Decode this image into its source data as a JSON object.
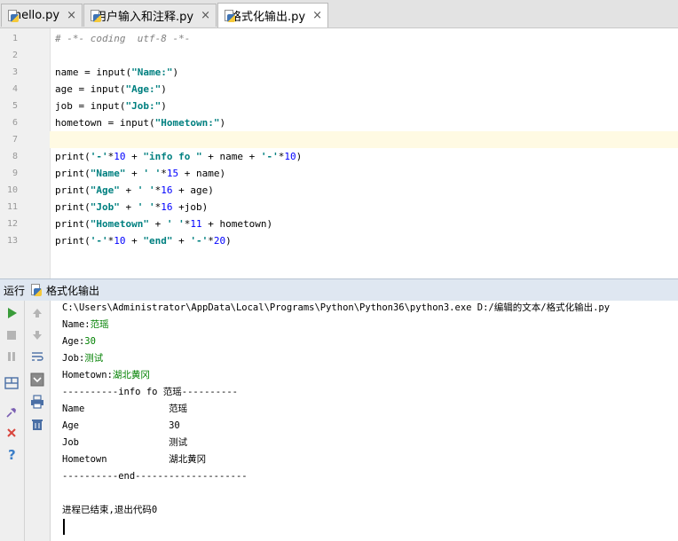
{
  "tabs": [
    {
      "label": "hello.py",
      "close": "×",
      "active": false
    },
    {
      "label": "用户输入和注释.py",
      "close": "×",
      "active": false
    },
    {
      "label": "格式化输出.py",
      "close": "×",
      "active": true
    }
  ],
  "editor": {
    "current_line": 7,
    "lines": [
      {
        "n": "1",
        "tokens": [
          {
            "t": "# -*- coding  utf-8 -*-",
            "k": "comment"
          }
        ]
      },
      {
        "n": "2",
        "tokens": []
      },
      {
        "n": "3",
        "tokens": [
          {
            "t": "name = input(",
            "k": "plain"
          },
          {
            "t": "\"Name:\"",
            "k": "str"
          },
          {
            "t": ")",
            "k": "plain"
          }
        ]
      },
      {
        "n": "4",
        "tokens": [
          {
            "t": "age = input(",
            "k": "plain"
          },
          {
            "t": "\"Age:\"",
            "k": "str"
          },
          {
            "t": ")",
            "k": "plain"
          }
        ]
      },
      {
        "n": "5",
        "tokens": [
          {
            "t": "job = input(",
            "k": "plain"
          },
          {
            "t": "\"Job:\"",
            "k": "str"
          },
          {
            "t": ")",
            "k": "plain"
          }
        ]
      },
      {
        "n": "6",
        "tokens": [
          {
            "t": "hometown = input(",
            "k": "plain"
          },
          {
            "t": "\"Hometown:\"",
            "k": "str"
          },
          {
            "t": ")",
            "k": "plain"
          }
        ]
      },
      {
        "n": "7",
        "tokens": []
      },
      {
        "n": "8",
        "tokens": [
          {
            "t": "print(",
            "k": "plain"
          },
          {
            "t": "'-'",
            "k": "str"
          },
          {
            "t": "*",
            "k": "plain"
          },
          {
            "t": "10",
            "k": "num"
          },
          {
            "t": " + ",
            "k": "plain"
          },
          {
            "t": "\"info fo \"",
            "k": "str"
          },
          {
            "t": " + name + ",
            "k": "plain"
          },
          {
            "t": "'-'",
            "k": "str"
          },
          {
            "t": "*",
            "k": "plain"
          },
          {
            "t": "10",
            "k": "num"
          },
          {
            "t": ")",
            "k": "plain"
          }
        ]
      },
      {
        "n": "9",
        "tokens": [
          {
            "t": "print(",
            "k": "plain"
          },
          {
            "t": "\"Name\"",
            "k": "str"
          },
          {
            "t": " + ",
            "k": "plain"
          },
          {
            "t": "' '",
            "k": "str"
          },
          {
            "t": "*",
            "k": "plain"
          },
          {
            "t": "15",
            "k": "num"
          },
          {
            "t": " + name)",
            "k": "plain"
          }
        ]
      },
      {
        "n": "10",
        "tokens": [
          {
            "t": "print(",
            "k": "plain"
          },
          {
            "t": "\"Age\"",
            "k": "str"
          },
          {
            "t": " + ",
            "k": "plain"
          },
          {
            "t": "' '",
            "k": "str"
          },
          {
            "t": "*",
            "k": "plain"
          },
          {
            "t": "16",
            "k": "num"
          },
          {
            "t": " + age)",
            "k": "plain"
          }
        ]
      },
      {
        "n": "11",
        "tokens": [
          {
            "t": "print(",
            "k": "plain"
          },
          {
            "t": "\"Job\"",
            "k": "str"
          },
          {
            "t": " + ",
            "k": "plain"
          },
          {
            "t": "' '",
            "k": "str"
          },
          {
            "t": "*",
            "k": "plain"
          },
          {
            "t": "16",
            "k": "num"
          },
          {
            "t": " +job)",
            "k": "plain"
          }
        ]
      },
      {
        "n": "12",
        "tokens": [
          {
            "t": "print(",
            "k": "plain"
          },
          {
            "t": "\"Hometown\"",
            "k": "str"
          },
          {
            "t": " + ",
            "k": "plain"
          },
          {
            "t": "' '",
            "k": "str"
          },
          {
            "t": "*",
            "k": "plain"
          },
          {
            "t": "11",
            "k": "num"
          },
          {
            "t": " + hometown)",
            "k": "plain"
          }
        ]
      },
      {
        "n": "13",
        "tokens": [
          {
            "t": "print(",
            "k": "plain"
          },
          {
            "t": "'-'",
            "k": "str"
          },
          {
            "t": "*",
            "k": "plain"
          },
          {
            "t": "10",
            "k": "num"
          },
          {
            "t": " + ",
            "k": "plain"
          },
          {
            "t": "\"end\"",
            "k": "str"
          },
          {
            "t": " + ",
            "k": "plain"
          },
          {
            "t": "'-'",
            "k": "str"
          },
          {
            "t": "*",
            "k": "plain"
          },
          {
            "t": "20",
            "k": "num"
          },
          {
            "t": ")",
            "k": "plain"
          }
        ]
      }
    ]
  },
  "run_panel": {
    "label": "运行",
    "config_name": "格式化输出",
    "toolbar_left": [
      {
        "icon": "run-icon",
        "color": "#3a9c3a"
      },
      {
        "icon": "stop-icon",
        "color": "#b5b5b5"
      },
      {
        "icon": "pause-icon",
        "color": "#b5b5b5"
      },
      {
        "icon": "layout-icon",
        "color": "#4a6fa5"
      },
      {
        "icon": "pin-icon",
        "color": "#7b5fb3"
      },
      {
        "icon": "close-icon",
        "color": "#d9453d"
      },
      {
        "icon": "help-icon",
        "color": "#3c7fc8"
      }
    ],
    "toolbar_right": [
      {
        "icon": "up-arrow-icon",
        "color": "#b5b5b5"
      },
      {
        "icon": "down-arrow-icon",
        "color": "#b5b5b5"
      },
      {
        "icon": "soft-wrap-icon",
        "color": "#4a6fa5"
      },
      {
        "icon": "scroll-to-end-icon",
        "color": "#555555"
      },
      {
        "icon": "print-icon",
        "color": "#4a6fa5"
      },
      {
        "icon": "trash-icon",
        "color": "#4a6fa5"
      }
    ],
    "console": [
      [
        {
          "t": "C:\\Users\\Administrator\\AppData\\Local\\Programs\\Python\\Python36\\python3.exe D:/编辑的文本/格式化输出.py",
          "c": "plain"
        }
      ],
      [
        {
          "t": "Name:",
          "c": "plain"
        },
        {
          "t": "范瑶",
          "c": "green"
        }
      ],
      [
        {
          "t": "Age:",
          "c": "plain"
        },
        {
          "t": "30",
          "c": "green"
        }
      ],
      [
        {
          "t": "Job:",
          "c": "plain"
        },
        {
          "t": "测试",
          "c": "green"
        }
      ],
      [
        {
          "t": "Hometown:",
          "c": "plain"
        },
        {
          "t": "湖北黄冈",
          "c": "green"
        }
      ],
      [
        {
          "t": "----------info fo 范瑶----------",
          "c": "plain"
        }
      ],
      [
        {
          "t": "Name               范瑶",
          "c": "plain"
        }
      ],
      [
        {
          "t": "Age                30",
          "c": "plain"
        }
      ],
      [
        {
          "t": "Job                测试",
          "c": "plain"
        }
      ],
      [
        {
          "t": "Hometown           湖北黄冈",
          "c": "plain"
        }
      ],
      [
        {
          "t": "----------end--------------------",
          "c": "plain"
        }
      ],
      [],
      [
        {
          "t": "进程已结束,退出代码0",
          "c": "plain"
        }
      ]
    ]
  }
}
